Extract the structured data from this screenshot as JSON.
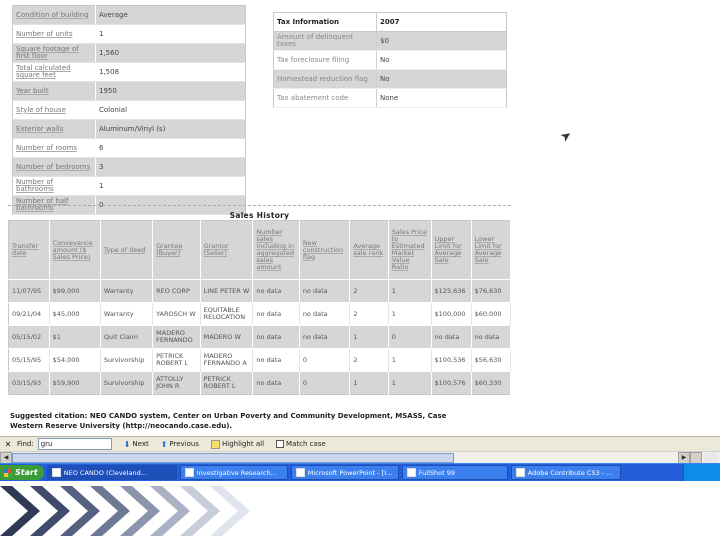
{
  "property": {
    "rows": [
      {
        "label": "Condition of building",
        "value": "Average"
      },
      {
        "label": "Number of units",
        "value": "1"
      },
      {
        "label": "Square footage of first floor",
        "value": "1,560"
      },
      {
        "label": "Total calculated square feet",
        "value": "1,508"
      },
      {
        "label": "Year built",
        "value": "1950"
      },
      {
        "label": "Style of house",
        "value": "Colonial"
      },
      {
        "label": "Exterior walls",
        "value": "Aluminum/Vinyl (s)"
      },
      {
        "label": "Number of rooms",
        "value": "6"
      },
      {
        "label": "Number of bedrooms",
        "value": "3"
      },
      {
        "label": "Number of bathrooms",
        "value": "1"
      },
      {
        "label": "Number of half bathrooms",
        "value": "0"
      }
    ]
  },
  "tax": {
    "header_label": "Tax Information",
    "header_year": "2007",
    "rows": [
      {
        "label": "Amount of delinquent taxes",
        "value": "$0"
      },
      {
        "label": "Tax foreclosure filing",
        "value": "No"
      },
      {
        "label": "Homestead reduction flag",
        "value": "No"
      },
      {
        "label": "Tax abatement code",
        "value": "None"
      }
    ]
  },
  "sales": {
    "title": "Sales History",
    "columns": [
      "Transfer date",
      "Conveyance amount ($ Sales Price)",
      "Type of deed",
      "Grantee (Buyer)",
      "Grantor (Seller)",
      "Number sales including in aggregated sales amount",
      "New construction flag",
      "Average sale rank",
      "Sales Price to Estimated Market Value Ratio",
      "Upper Limit for Average Sale",
      "Lower Limit for Average Sale"
    ],
    "rows": [
      [
        "11/07/95",
        "$99,000",
        "Warranty",
        "REO CORP",
        "LINE PETER W",
        "no data",
        "no data",
        "2",
        "1",
        "$125,636",
        "$76,630"
      ],
      [
        "09/21/04",
        "$45,000",
        "Warranty",
        "YAROSCH W",
        "EQUITABLE RELOCATION",
        "no data",
        "no data",
        "2",
        "1",
        "$100,000",
        "$60,000"
      ],
      [
        "05/15/02",
        "$1",
        "Quit Claim",
        "MADERO FERNANDO",
        "MADERO W",
        "no data",
        "no data",
        "1",
        "0",
        "no data",
        "no data"
      ],
      [
        "05/15/95",
        "$54,000",
        "Survivorship",
        "PETRICK ROBERT L",
        "MADERO FERNANDO A",
        "no data",
        "0",
        "2",
        "1",
        "$100,536",
        "$56,630"
      ],
      [
        "03/15/93",
        "$59,900",
        "Survivorship",
        "ATTOLLY JOHN R",
        "PETRICK ROBERT L",
        "no data",
        "0",
        "1",
        "1",
        "$100,576",
        "$60,330"
      ]
    ]
  },
  "footnote": "Suggested citation: NEO CANDO system, Center on Urban Poverty and Community Development, MSASS, Case Western Reserve University (http://neocando.case.edu).",
  "findbar": {
    "label": "Find:",
    "value": "gru",
    "next": "Next",
    "previous": "Previous",
    "highlight": "Highlight all",
    "match_case": "Match case"
  },
  "taskbar": {
    "start": "Start",
    "tasks": [
      "NEO CANDO (Cleveland...",
      "Investigative Research...",
      "Microsoft PowerPoint - [I...",
      "FullShot 99",
      "Adobe Contribute CS3 - ..."
    ]
  }
}
